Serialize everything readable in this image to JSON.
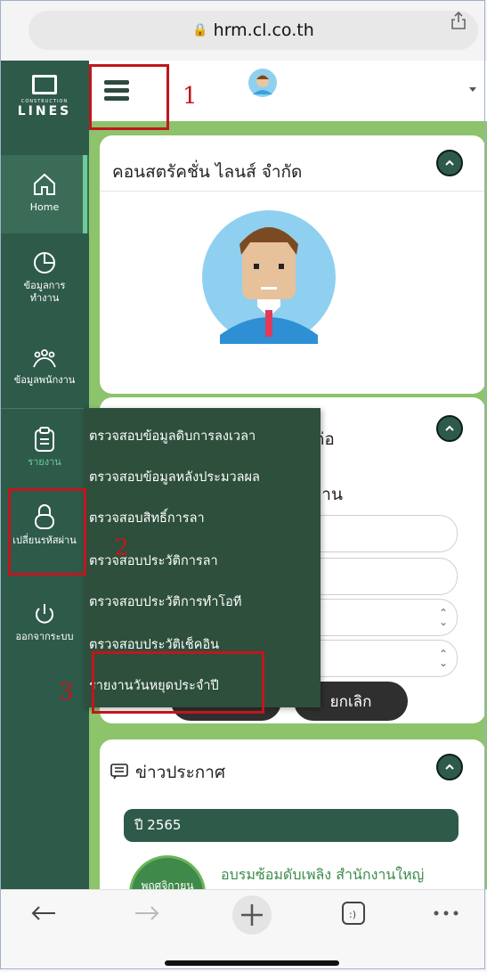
{
  "browser": {
    "url": "hrm.cl.co.th"
  },
  "logo": {
    "small": "CONSTRUCTION",
    "big": "LINES"
  },
  "sidebar": {
    "items": [
      {
        "label": "Home"
      },
      {
        "label": "ข้อมูลการทำงาน"
      },
      {
        "label": "ข้อมูลพนักงาน"
      },
      {
        "label": "รายงาน"
      },
      {
        "label": "เปลี่ยนรหัสผ่าน"
      },
      {
        "label": "ออกจากระบบ"
      }
    ]
  },
  "profile_card": {
    "company": "คอนสตรัคชั่น ไลนส์ จำกัด"
  },
  "form_card": {
    "title_suffix": "ต่อ",
    "subtitle_suffix": "งาน",
    "cancel_label": "ยกเลิก"
  },
  "menu": {
    "items": [
      "ตรวจสอบข้อมูลดิบการลงเวลา",
      "ตรวจสอบข้อมูลหลังประมวลผล",
      "ตรวจสอบสิทธิ์การลา",
      "ตรวจสอบประวัติการลา",
      "ตรวจสอบประวัติการทำโอที",
      "ตรวจสอบประวัติเช็คอิน",
      "รายงานวันหยุดประจำปี"
    ]
  },
  "annotations": {
    "n1": "1",
    "n2": "2",
    "n3": "3"
  },
  "news": {
    "title": "ข่าวประกาศ",
    "year": "ปี 2565",
    "month": "พฤศจิกายน",
    "headline": "อบรมซ้อมดับเพลิง สำนักงานใหญ่"
  },
  "colors": {
    "sidebar": "#2e5a4a",
    "accent_green": "#8dc36b",
    "annotation_red": "#c0171d"
  },
  "icons": [
    "lock-icon",
    "share-icon",
    "hamburger-icon",
    "home-icon",
    "pie-chart-icon",
    "group-icon",
    "clipboard-icon",
    "padlock-icon",
    "power-icon",
    "chevron-up-icon",
    "message-icon",
    "back-arrow-icon",
    "forward-arrow-icon",
    "plus-icon",
    "tabs-icon",
    "more-icon"
  ]
}
